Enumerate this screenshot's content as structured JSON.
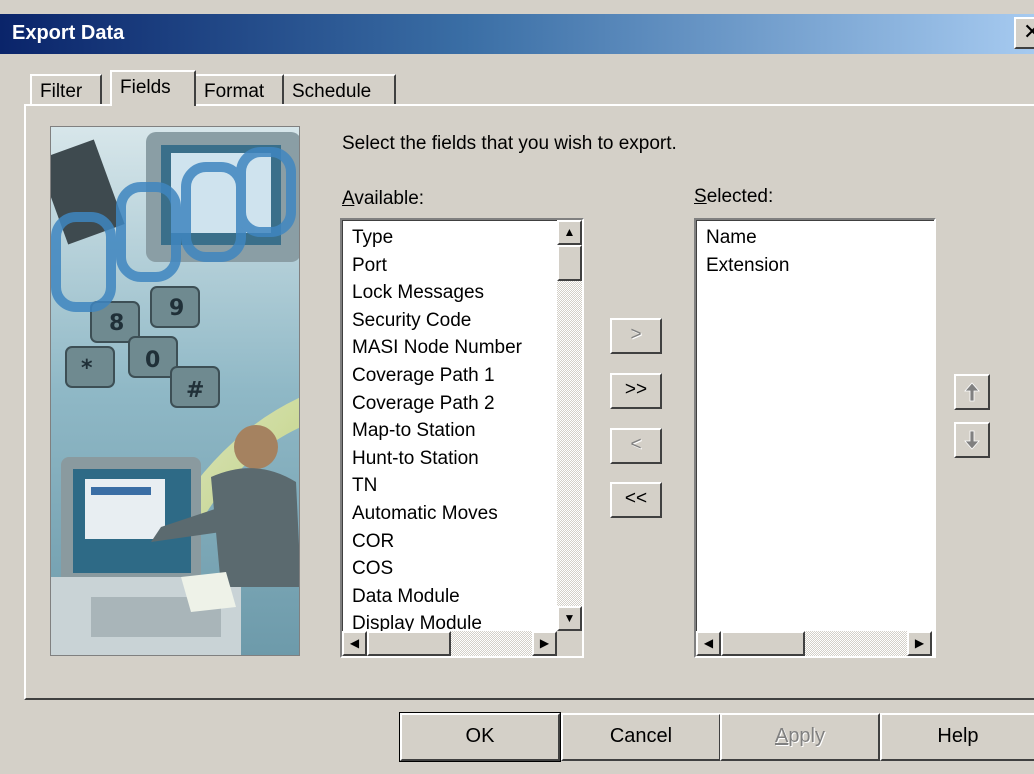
{
  "window": {
    "title": "Export Data",
    "close_glyph": "✕"
  },
  "tabs": [
    {
      "label": "Filter"
    },
    {
      "label": "Fields"
    },
    {
      "label": "Format"
    },
    {
      "label": "Schedule"
    }
  ],
  "active_tab": "Fields",
  "fields_page": {
    "instruction": "Select the fields that you wish to export.",
    "available_label_accel": "A",
    "available_label_rest": "vailable:",
    "selected_label_accel": "S",
    "selected_label_rest": "elected:",
    "available_items": [
      "Type",
      "Port",
      "Lock Messages",
      "Security Code",
      "MASI Node Number",
      "Coverage Path 1",
      "Coverage Path 2",
      "Map-to Station",
      "Hunt-to Station",
      "TN",
      "Automatic Moves",
      "COR",
      "COS",
      "Data Module",
      "Display Module"
    ],
    "selected_items": [
      "Name",
      "Extension"
    ],
    "move_buttons": {
      "add": ">",
      "add_all": ">>",
      "remove": "<",
      "remove_all": "<<"
    },
    "order_buttons": {
      "up_icon": "move-up-arrow",
      "down_icon": "move-down-arrow"
    }
  },
  "buttons": {
    "ok": "OK",
    "cancel": "Cancel",
    "apply_accel": "A",
    "apply_rest": "pply",
    "help": "Help"
  }
}
